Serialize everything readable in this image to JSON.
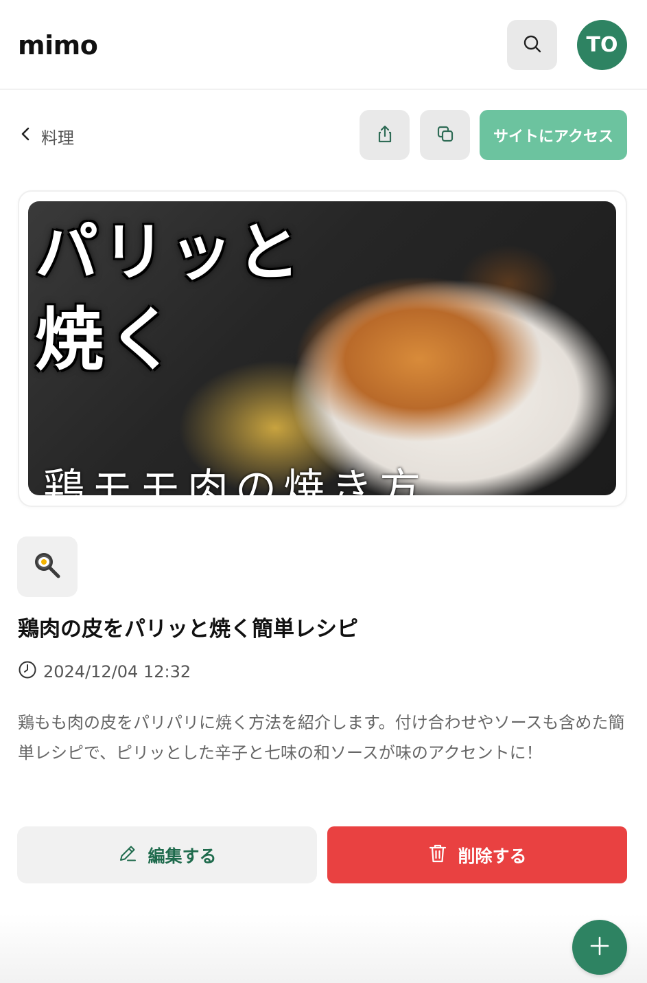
{
  "app": {
    "logo": "mimo",
    "avatar_initials": "TO"
  },
  "colors": {
    "brand_green": "#2e8362",
    "accent_green": "#6cc39f",
    "danger_red": "#e94141"
  },
  "toolbar": {
    "back_label": "料理",
    "visit_label": "サイトにアクセス",
    "icons": [
      "search-icon",
      "share-icon",
      "copy-icon"
    ]
  },
  "thumbnail": {
    "line1": "パリッと",
    "line2": "焼く",
    "bottom": "鶏モモ肉の焼き方"
  },
  "item": {
    "emoji": "🍳",
    "title": "鶏肉の皮をパリッと焼く簡単レシピ",
    "date": "2024/12/04 12:32",
    "description": "鶏もも肉の皮をパリパリに焼く方法を紹介します。付け合わせやソースも含めた簡単レシピで、ピリッとした辛子と七味の和ソースが味のアクセントに！"
  },
  "actions": {
    "edit_label": "編集する",
    "delete_label": "削除する"
  }
}
